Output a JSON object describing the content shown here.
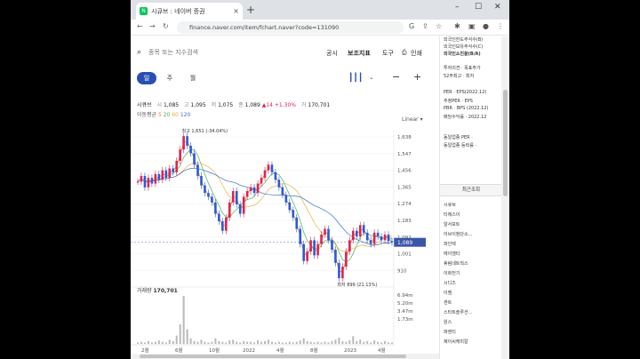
{
  "browser": {
    "tab_title": "시큐브 : 네이버 증권",
    "tab_close": "×",
    "new_tab": "+",
    "url": "finance.naver.com/item/fchart.naver?code=131090",
    "window_controls": [
      "–",
      "☐",
      "✕"
    ]
  },
  "chart_app": {
    "search_placeholder": "종목 또는 지수검색",
    "header_links": [
      "공시",
      "보조지표",
      "도구",
      "인쇄"
    ],
    "period_tabs": [
      "일",
      "주",
      "월"
    ],
    "active_period": "일",
    "quote": {
      "name": "시큐브",
      "open_label": "시",
      "open": "1,085",
      "high_label": "고",
      "high": "1,095",
      "low_label": "저",
      "low": "1,075",
      "close_label": "종",
      "close": "1,089",
      "change": "▲14",
      "change_pct": "+1.30%",
      "volume_label": "거",
      "volume": "170,701"
    },
    "ma_label": "이동평균",
    "ma_values": [
      "5",
      "20",
      "60",
      "120"
    ],
    "scale_label": "Linear",
    "volume_title": "거래량",
    "volume_value": "170,701"
  },
  "chart_data": {
    "type": "line",
    "title": "",
    "price_ticks": [
      "1,638",
      "1,547",
      "1,456",
      "1,365",
      "1,274",
      "1,183",
      "1,092",
      "1,001",
      "910"
    ],
    "current_price_tag": "1,089",
    "volume_ticks": [
      "6.94m",
      "5.20m",
      "3.47m",
      "1.73m"
    ],
    "x_ticks": [
      "2월",
      "6월",
      "10월",
      "2022",
      "4월",
      "8월",
      "2023",
      "4월"
    ],
    "annotations": {
      "high": "최고 1,651 (-34.04%)",
      "low": "최저 899 (21.13%)"
    },
    "ylim": [
      890,
      1680
    ],
    "x": [
      0,
      1,
      2,
      3,
      4,
      5,
      6,
      7,
      8,
      9,
      10,
      11,
      12,
      13,
      14,
      15,
      16,
      17,
      18,
      19,
      20,
      21,
      22,
      23,
      24,
      25,
      26,
      27,
      28,
      29,
      30,
      31,
      32,
      33,
      34,
      35,
      36,
      37,
      38,
      39,
      40,
      41,
      42,
      43,
      44,
      45,
      46,
      47,
      48,
      49,
      50,
      51,
      52,
      53,
      54,
      55,
      56,
      57,
      58,
      59,
      60,
      61,
      62,
      63,
      64,
      65,
      66,
      67,
      68,
      69,
      70,
      71,
      72
    ],
    "series": [
      {
        "values": [
          1410,
          1440,
          1380,
          1430,
          1400,
          1450,
          1420,
          1470,
          1430,
          1480,
          1460,
          1520,
          1580,
          1651,
          1600,
          1560,
          1500,
          1440,
          1390,
          1350,
          1330,
          1300,
          1240,
          1200,
          1150,
          1220,
          1300,
          1360,
          1290,
          1240,
          1330,
          1360,
          1380,
          1350,
          1400,
          1430,
          1470,
          1500,
          1460,
          1420,
          1380,
          1340,
          1300,
          1260,
          1220,
          1160,
          1080,
          990,
          1040,
          1100,
          1020,
          1080,
          1130,
          1160,
          1100,
          1050,
          980,
          899,
          960,
          1040,
          1100,
          1150,
          1120,
          1180,
          1140,
          1100,
          1080,
          1140,
          1120,
          1100,
          1130,
          1095,
          1089
        ]
      }
    ],
    "volume_series": [
      0.2,
      0.3,
      0.2,
      0.4,
      0.2,
      0.3,
      0.5,
      0.3,
      0.2,
      0.6,
      0.4,
      1.2,
      2.8,
      6.9,
      2.1,
      0.8,
      0.4,
      0.3,
      0.6,
      0.3,
      0.2,
      0.3,
      0.8,
      0.4,
      0.3,
      0.2,
      0.5,
      0.6,
      0.3,
      0.2,
      0.4,
      0.3,
      0.3,
      0.2,
      0.5,
      0.3,
      0.4,
      0.6,
      0.3,
      0.2,
      0.3,
      0.2,
      0.2,
      0.3,
      0.2,
      0.3,
      0.5,
      0.8,
      0.4,
      0.3,
      0.2,
      0.3,
      0.2,
      0.3,
      0.2,
      0.4,
      0.6,
      0.9,
      0.4,
      0.3,
      0.5,
      1.1,
      0.4,
      0.6,
      0.3,
      0.4,
      0.2,
      0.5,
      0.3,
      0.2,
      0.4,
      0.2,
      0.2
    ],
    "ma_colors": {
      "ma5": "#e07b39",
      "ma20": "#4caf50",
      "ma60": "#e8b33a",
      "ma120": "#3b6fd6"
    },
    "candle_up_color": "#e0234e",
    "candle_down_color": "#2a5bd7"
  },
  "side_panel": {
    "top_lines": [
      "외국인한도주식수(B)",
      "외국인보유주식수(C)",
      "외국인소진율(B/A)"
    ],
    "mid_lines": [
      "투자의견 · 목표주가",
      "52주최고 · 최저"
    ],
    "per_lines": [
      "PER · EPS(2022.12)",
      "추정PER · EPS",
      "PBR · BPS (2022.12)",
      "배당수익률 · 2022.12"
    ],
    "industry_lines": [
      "동일업종 PER ·",
      "동일업종 등락률 ·"
    ],
    "recent_title": "최근조회",
    "recent_items": [
      "시큐브",
      "티에스이",
      "알서포트",
      "이브이첨단소...",
      "파인텍",
      "에이엠티",
      "휴림네트웍스",
      "이화전기",
      "시디즈",
      "이젬",
      "센트",
      "스타트솔루션...",
      "원스",
      "파엔티",
      "제이씨케미칼"
    ]
  }
}
